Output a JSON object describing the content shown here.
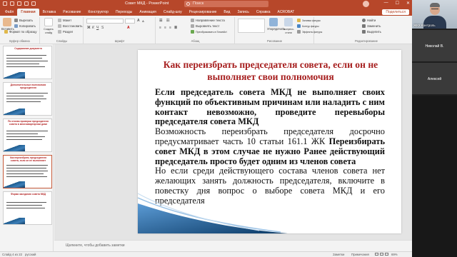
{
  "window": {
    "title": "Совет МКД  -  PowerPoint",
    "search_placeholder": "Поиск",
    "minimize": "—",
    "maximize": "☐",
    "close": "✕"
  },
  "tabs": [
    "Файл",
    "Главная",
    "Вставка",
    "Рисование",
    "Конструктор",
    "Переходы",
    "Анимация",
    "Слайд-шоу",
    "Рецензирование",
    "Вид",
    "Запись",
    "Справка",
    "ACROBAT"
  ],
  "active_tab": "Главная",
  "share_label": "Поделиться",
  "ribbon": {
    "paste": "Вставить",
    "cut": "Вырезать",
    "copy": "Копировать",
    "format_painter": "Формат по образцу",
    "clipboard": "Буфер обмена",
    "new_slide": "Создать слайд",
    "reuse": "Повторно использовать слайды",
    "layout": "Макет",
    "reset": "Восстановить",
    "section": "Раздел",
    "slides": "Слайды",
    "font": "Шрифт",
    "paragraph": "Абзац",
    "text_direction": "Направление текста",
    "align_text": "Выровнять текст",
    "smartart": "Преобразовать в SmartArt",
    "arrange": "Упорядочить",
    "quick_styles": "Экспресс-стили",
    "drawing": "Рисование",
    "fill": "Заливка фигуры",
    "outline": "Контур фигуры",
    "effects": "Эффекты фигуры",
    "find": "Найти",
    "replace": "Заменить",
    "select": "Выделить",
    "editing": "Редактирование"
  },
  "thumbnails": [
    {
      "num": "",
      "title": "Содержание документа"
    },
    {
      "num": "",
      "title": "Дополнительные полномочия председателя"
    },
    {
      "num": "",
      "title": "По итогам проверки председателя совета в многоквартирном доме"
    },
    {
      "num": "",
      "title": "Как переизбрать председателя совета, если он не выполняет"
    },
    {
      "num": "",
      "title": "Форма заседания совета МКД"
    }
  ],
  "slide": {
    "title": "Как переизбрать председателя совета, если он не выполняет свои полномочия",
    "p1": "Если председатель совета МКД не выполняет своих функций по объективным причинам или наладить с ним контакт невозможно, проведите перевыборы председателя совета МКД",
    "p2_normal": "Возможность переизбрать председателя досрочно предусматривает часть 10 статьи 161.1 ЖК ",
    "p2_bold": "Переизбирать совет МКД в этом случае не нужно Ранее действующий председатель просто будет одним из членов совета",
    "p3": "Но если среди действующего состава членов совета нет желающих занять должность председателя, включите в повестку дня вопрос о выборе совета МКД и его председателя"
  },
  "notes_placeholder": "Щелкните, чтобы добавить заметки",
  "status": {
    "slide_counter": "Слайд 4 из 22",
    "language": "русский",
    "notes": "Заметки",
    "comments": "Примечания",
    "zoom": "69%"
  },
  "participants": {
    "self": "ЖКХ Контроль",
    "p1": "Николай В.",
    "p2": "Алексей"
  },
  "colors": {
    "accent": "#b7472a",
    "slide_title": "#a61e1e"
  }
}
